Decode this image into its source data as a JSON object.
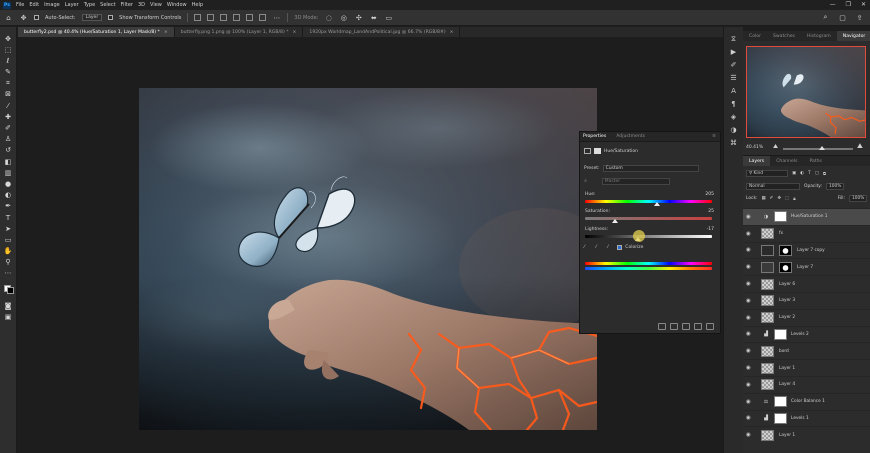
{
  "app": {
    "logo": "Ps",
    "menus": [
      "File",
      "Edit",
      "Image",
      "Layer",
      "Type",
      "Select",
      "Filter",
      "3D",
      "View",
      "Window",
      "Help"
    ],
    "window_controls": [
      "—",
      "❐",
      "✕"
    ]
  },
  "options_bar": {
    "auto_select_label": "Auto-Select:",
    "auto_select_target": "Layer",
    "show_transform_label": "Show Transform Controls",
    "mode_3d_label": "3D Mode:"
  },
  "tabs": [
    {
      "label": "butterfly2.psd @ 40.4% (Hue/Saturation 1, Layer Mask/8) *",
      "close": "×"
    },
    {
      "label": "butterfly.png 1.png @ 100% (Layer 1, RGB/8) *",
      "close": "×"
    },
    {
      "label": "1920px Worldmap_LandAndPolitical.jpg @ 66.7% (RGB/8#)",
      "close": "×"
    }
  ],
  "toolbar": {
    "tools": [
      "move-icon",
      "marquee-icon",
      "lasso-icon",
      "quick-select-icon",
      "crop-icon",
      "frame-icon",
      "eyedropper-icon",
      "healing-icon",
      "brush-icon",
      "clone-stamp-icon",
      "history-brush-icon",
      "eraser-icon",
      "gradient-icon",
      "blur-icon",
      "dodge-icon",
      "pen-icon",
      "type-icon",
      "path-select-icon",
      "rectangle-icon",
      "hand-icon",
      "zoom-icon",
      "more-tools-icon"
    ]
  },
  "properties": {
    "tab_properties": "Properties",
    "tab_adjustments": "Adjustments",
    "title": "Hue/Saturation",
    "preset_label": "Preset:",
    "preset_value": "Custom",
    "channel_value": "Master",
    "hue_label": "Hue:",
    "hue_value": "205",
    "hue_fraction": 0.57,
    "saturation_label": "Saturation:",
    "saturation_value": "25",
    "saturation_fraction": 0.24,
    "lightness_label": "Lightness:",
    "lightness_value": "-17",
    "lightness_fraction": 0.42,
    "colorize_label": "Colorize"
  },
  "navigator": {
    "tabs": [
      "Color",
      "Swatches",
      "Histogram",
      "Navigator"
    ],
    "active": "Navigator",
    "zoom": "40.41%"
  },
  "layers": {
    "tabs": [
      "Layers",
      "Channels",
      "Paths"
    ],
    "filter_kind": "Kind",
    "blend_mode": "Normal",
    "opacity_label": "Opacity:",
    "opacity_value": "100%",
    "lock_label": "Lock:",
    "fill_label": "Fill:",
    "fill_value": "100%",
    "items": [
      {
        "name": "Hue/Saturation 1",
        "type": "adjustment",
        "adj_icon": "hue-sat-icon",
        "selected": true
      },
      {
        "name": "fx",
        "type": "layer"
      },
      {
        "name": "Layer 7 copy",
        "type": "masked"
      },
      {
        "name": "Layer 7",
        "type": "masked"
      },
      {
        "name": "Layer 6",
        "type": "layer"
      },
      {
        "name": "Layer 3",
        "type": "layer"
      },
      {
        "name": "Layer 2",
        "type": "layer"
      },
      {
        "name": "Levels 2",
        "type": "adjustment",
        "adj_icon": "levels-icon"
      },
      {
        "name": "bord",
        "type": "layer"
      },
      {
        "name": "Layer 1",
        "type": "layer"
      },
      {
        "name": "Layer 4",
        "type": "layer"
      },
      {
        "name": "Color Balance 1",
        "type": "adjustment",
        "adj_icon": "balance-icon"
      },
      {
        "name": "Levels 1",
        "type": "adjustment",
        "adj_icon": "levels-icon"
      },
      {
        "name": "Layer 1",
        "type": "layer"
      }
    ]
  },
  "colors": {
    "accent_red": "#e14b3b",
    "lava": "#ff5a1a",
    "sky": "#3c5a73"
  }
}
